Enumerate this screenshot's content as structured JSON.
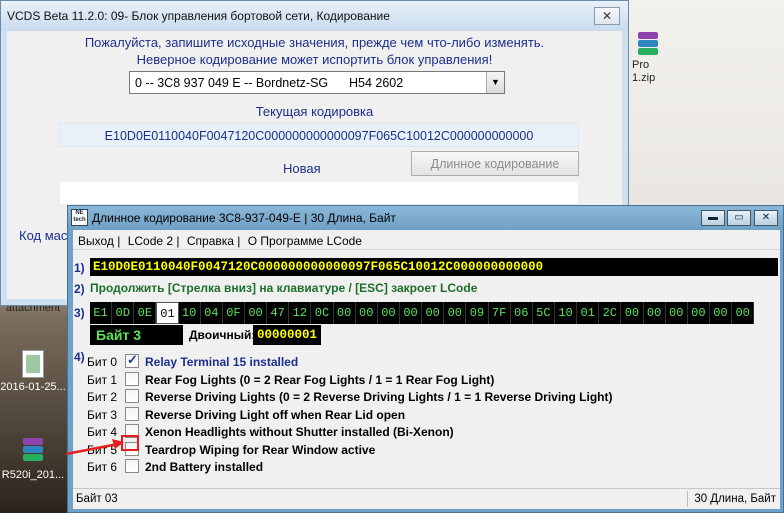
{
  "desktop": {
    "icons": [
      {
        "label": "Pro\n1.zip"
      },
      {
        "label": "attachment"
      },
      {
        "label": "2016-01-25..."
      },
      {
        "label": "R520i_201..."
      }
    ]
  },
  "vcds": {
    "title": "VCDS Beta 11.2.0: 09- Блок управления бортовой сети,  Кодирование",
    "close": "✕",
    "warning_line1": "Пожалуйста, запишите исходные значения, прежде чем что-либо изменять.",
    "warning_line2": "Неверное кодирование может испортить блок управления!",
    "module_select": "0 -- 3C8 937 049 E -- Bordnetz-SG      H54 2602",
    "current_label": "Текущая кодировка",
    "current_value": "E10D0E0110040F0047120C000000000000097F065C10012C000000000000",
    "new_label": "Новая",
    "long_coding_button": "Длинное кодирование",
    "left_label": "Код мас"
  },
  "lcode": {
    "logo": "NE tech",
    "title": "Длинное кодирование  3C8-937-049-E | 30 Длина, Байт",
    "menu": [
      "Выход |",
      "LCode 2 |",
      "Справка |",
      "О Программе LCode"
    ],
    "row1_num": "1)",
    "hex_line": "E10D0E0110040F0047120C000000000000097F065C10012C000000000000",
    "row2_num": "2)",
    "hint": "Продолжить [Стрелка вниз] на клавиатуре / [ESC] закроет LCode",
    "row3_num": "3)",
    "bytes": [
      "E1",
      "0D",
      "0E",
      "01",
      "10",
      "04",
      "0F",
      "00",
      "47",
      "12",
      "0C",
      "00",
      "00",
      "00",
      "00",
      "00",
      "00",
      "09",
      "7F",
      "06",
      "5C",
      "10",
      "01",
      "2C",
      "00",
      "00",
      "00",
      "00",
      "00",
      "00"
    ],
    "selected_byte_index": 3,
    "byte_title": "Байт 3",
    "binary_label": "Двоичный:",
    "binary_value": "00000001",
    "row4_num": "4)",
    "bits": [
      {
        "name": "Бит 0",
        "checked": true,
        "desc": "Relay Terminal 15 installed"
      },
      {
        "name": "Бит 1",
        "checked": false,
        "desc": "Rear Fog Lights (0 = 2 Rear Fog Lights / 1 = 1 Rear Fog Light)"
      },
      {
        "name": "Бит 2",
        "checked": false,
        "desc": "Reverse Driving Lights (0 = 2 Reverse Driving Lights / 1 = 1 Reverse Driving Light)"
      },
      {
        "name": "Бит 3",
        "checked": false,
        "desc": "Reverse Driving Light off when Rear Lid open"
      },
      {
        "name": "Бит 4",
        "checked": false,
        "desc": "Xenon Headlights without Shutter installed (Bi-Xenon)"
      },
      {
        "name": "Бит 5",
        "checked": false,
        "desc": "Teardrop Wiping for Rear Window active"
      },
      {
        "name": "Бит 6",
        "checked": false,
        "desc": "2nd Battery installed"
      }
    ],
    "status_left": "Байт 03",
    "status_right": "30 Длина, Байт"
  },
  "colors": {
    "accent_blue": "#1d2f8c",
    "hex_yellow": "#ffff00",
    "byte_green": "#5be35b",
    "annotation_red": "#e32020"
  }
}
